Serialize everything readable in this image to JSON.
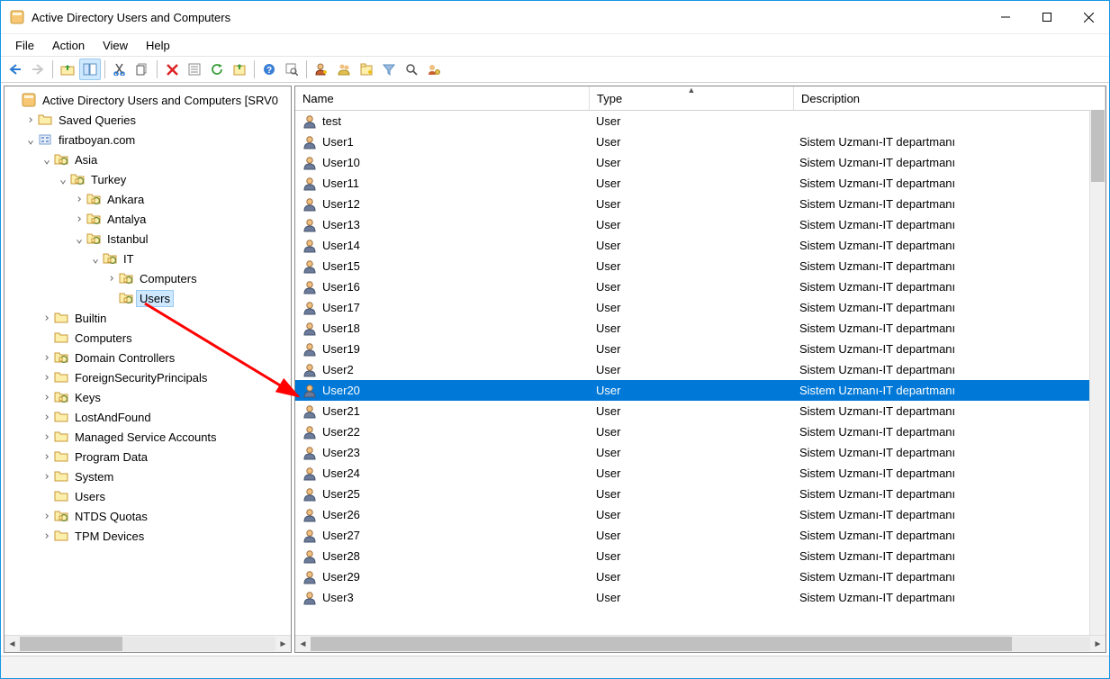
{
  "window": {
    "title": "Active Directory Users and Computers"
  },
  "menu": {
    "file": "File",
    "action": "Action",
    "view": "View",
    "help": "Help"
  },
  "tree": {
    "root": "Active Directory Users and Computers [SRV0",
    "saved_queries": "Saved Queries",
    "domain": "firatboyan.com",
    "asia": "Asia",
    "turkey": "Turkey",
    "ankara": "Ankara",
    "antalya": "Antalya",
    "istanbul": "Istanbul",
    "it": "IT",
    "computers_ou": "Computers",
    "users_ou": "Users",
    "builtin": "Builtin",
    "computers": "Computers",
    "domain_controllers": "Domain Controllers",
    "fsp": "ForeignSecurityPrincipals",
    "keys": "Keys",
    "lost_and_found": "LostAndFound",
    "msa": "Managed Service Accounts",
    "program_data": "Program Data",
    "system": "System",
    "users": "Users",
    "ntds_quotas": "NTDS Quotas",
    "tpm_devices": "TPM Devices"
  },
  "columns": {
    "name": "Name",
    "type": "Type",
    "description": "Description"
  },
  "rows": [
    {
      "name": "test",
      "type": "User",
      "desc": "",
      "selected": false
    },
    {
      "name": "User1",
      "type": "User",
      "desc": "Sistem Uzmanı-IT departmanı",
      "selected": false
    },
    {
      "name": "User10",
      "type": "User",
      "desc": "Sistem Uzmanı-IT departmanı",
      "selected": false
    },
    {
      "name": "User11",
      "type": "User",
      "desc": "Sistem Uzmanı-IT departmanı",
      "selected": false
    },
    {
      "name": "User12",
      "type": "User",
      "desc": "Sistem Uzmanı-IT departmanı",
      "selected": false
    },
    {
      "name": "User13",
      "type": "User",
      "desc": "Sistem Uzmanı-IT departmanı",
      "selected": false
    },
    {
      "name": "User14",
      "type": "User",
      "desc": "Sistem Uzmanı-IT departmanı",
      "selected": false
    },
    {
      "name": "User15",
      "type": "User",
      "desc": "Sistem Uzmanı-IT departmanı",
      "selected": false
    },
    {
      "name": "User16",
      "type": "User",
      "desc": "Sistem Uzmanı-IT departmanı",
      "selected": false
    },
    {
      "name": "User17",
      "type": "User",
      "desc": "Sistem Uzmanı-IT departmanı",
      "selected": false
    },
    {
      "name": "User18",
      "type": "User",
      "desc": "Sistem Uzmanı-IT departmanı",
      "selected": false
    },
    {
      "name": "User19",
      "type": "User",
      "desc": "Sistem Uzmanı-IT departmanı",
      "selected": false
    },
    {
      "name": "User2",
      "type": "User",
      "desc": "Sistem Uzmanı-IT departmanı",
      "selected": false
    },
    {
      "name": "User20",
      "type": "User",
      "desc": "Sistem Uzmanı-IT departmanı",
      "selected": true
    },
    {
      "name": "User21",
      "type": "User",
      "desc": "Sistem Uzmanı-IT departmanı",
      "selected": false
    },
    {
      "name": "User22",
      "type": "User",
      "desc": "Sistem Uzmanı-IT departmanı",
      "selected": false
    },
    {
      "name": "User23",
      "type": "User",
      "desc": "Sistem Uzmanı-IT departmanı",
      "selected": false
    },
    {
      "name": "User24",
      "type": "User",
      "desc": "Sistem Uzmanı-IT departmanı",
      "selected": false
    },
    {
      "name": "User25",
      "type": "User",
      "desc": "Sistem Uzmanı-IT departmanı",
      "selected": false
    },
    {
      "name": "User26",
      "type": "User",
      "desc": "Sistem Uzmanı-IT departmanı",
      "selected": false
    },
    {
      "name": "User27",
      "type": "User",
      "desc": "Sistem Uzmanı-IT departmanı",
      "selected": false
    },
    {
      "name": "User28",
      "type": "User",
      "desc": "Sistem Uzmanı-IT departmanı",
      "selected": false
    },
    {
      "name": "User29",
      "type": "User",
      "desc": "Sistem Uzmanı-IT departmanı",
      "selected": false
    },
    {
      "name": "User3",
      "type": "User",
      "desc": "Sistem Uzmanı-IT departmanı",
      "selected": false
    }
  ],
  "col_widths": {
    "name": 310,
    "type": 210,
    "desc": 350
  }
}
